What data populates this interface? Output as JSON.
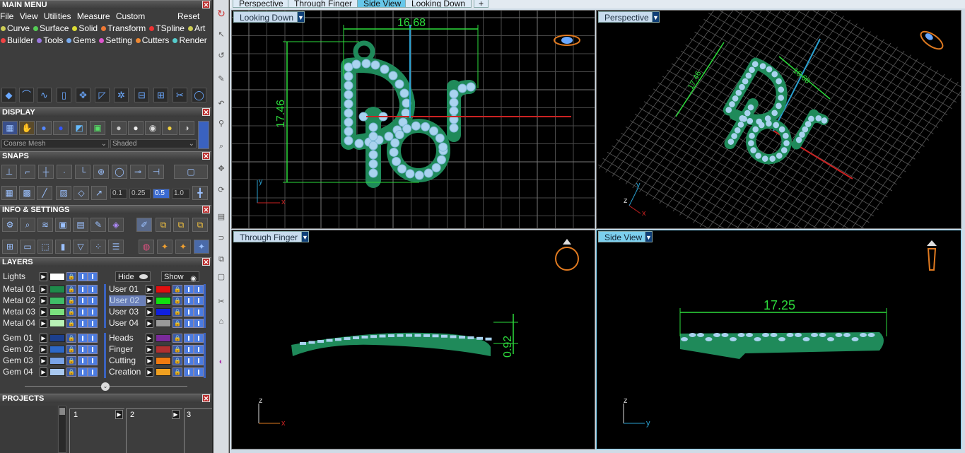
{
  "main_menu": {
    "title": "MAIN MENU",
    "menu": [
      "File",
      "View",
      "Utilities",
      "Measure",
      "Custom"
    ],
    "reset": "Reset",
    "row1": [
      {
        "label": "Curve",
        "color": "#cccc55"
      },
      {
        "label": "Surface",
        "color": "#55cc55"
      },
      {
        "label": "Solid",
        "color": "#dddd33"
      },
      {
        "label": "Transform",
        "color": "#ee7733"
      },
      {
        "label": "TSpline",
        "color": "#ee3333"
      },
      {
        "label": "Art",
        "color": "#cccc55"
      }
    ],
    "row2": [
      {
        "label": "Builder",
        "color": "#ee4444"
      },
      {
        "label": "Tools",
        "color": "#9977dd"
      },
      {
        "label": "Gems",
        "color": "#77aaee"
      },
      {
        "label": "Setting",
        "color": "#dd55cc"
      },
      {
        "label": "Cutters",
        "color": "#ee8833"
      },
      {
        "label": "Render",
        "color": "#55cccc"
      }
    ]
  },
  "display": {
    "title": "DISPLAY",
    "mesh": "Coarse Mesh",
    "shading": "Shaded"
  },
  "snaps": {
    "title": "SNAPS",
    "values": [
      "0.1",
      "0.25",
      "0.5",
      "1.0"
    ]
  },
  "info": {
    "title": "INFO & SETTINGS"
  },
  "layers": {
    "title": "LAYERS",
    "lights": "Lights",
    "hide": "Hide",
    "show": "Show",
    "left": [
      {
        "name": "Metal 01",
        "color": "#1e8a4a"
      },
      {
        "name": "Metal 02",
        "color": "#3fbf68"
      },
      {
        "name": "Metal 03",
        "color": "#7be07e"
      },
      {
        "name": "Metal 04",
        "color": "#b9f2b6"
      },
      {
        "name": "Gem 01",
        "color": "#1c3f8c"
      },
      {
        "name": "Gem 02",
        "color": "#2d68c8"
      },
      {
        "name": "Gem 03",
        "color": "#7aa4e8"
      },
      {
        "name": "Gem 04",
        "color": "#a8c8f0"
      }
    ],
    "right": [
      {
        "name": "User 01",
        "color": "#e01010"
      },
      {
        "name": "User 02",
        "color": "#10e010"
      },
      {
        "name": "User 03",
        "color": "#1020e0"
      },
      {
        "name": "User 04",
        "color": "#9a9a9a"
      },
      {
        "name": "Heads",
        "color": "#7a2a9a"
      },
      {
        "name": "Finger",
        "color": "#b03030"
      },
      {
        "name": "Cutting",
        "color": "#f07a10"
      },
      {
        "name": "Creation",
        "color": "#f0a020"
      }
    ]
  },
  "projects": {
    "title": "PROJECTS",
    "slots": [
      "1",
      "2",
      "3"
    ]
  },
  "tabs": [
    "Perspective",
    "Through Finger",
    "Side View",
    "Looking Down"
  ],
  "add_tab": "+",
  "viewports": {
    "looking_down": {
      "label": "Looking Down",
      "dim_width": "16.68",
      "dim_height": "17.46",
      "axis_x": "x",
      "axis_y": "y"
    },
    "perspective": {
      "label": "Perspective",
      "dim_width": "16.68",
      "dim_height": "17.46",
      "axis_y": "y",
      "axis_z": "z",
      "axis_x": "x"
    },
    "through_finger": {
      "label": "Through Finger",
      "dim_thickness": "0.92",
      "axis_z": "z",
      "axis_x": "x"
    },
    "side_view": {
      "label": "Side View",
      "dim_length": "17.25",
      "axis_z": "z",
      "axis_y": "y"
    }
  },
  "colors": {
    "metal": "#1f8a5a",
    "gem": "#a9d3ef",
    "dimension": "#2ddc3c",
    "grid": "#4a4a4a",
    "x_axis": "#cc2222",
    "y_axis": "#2aa0d0"
  }
}
